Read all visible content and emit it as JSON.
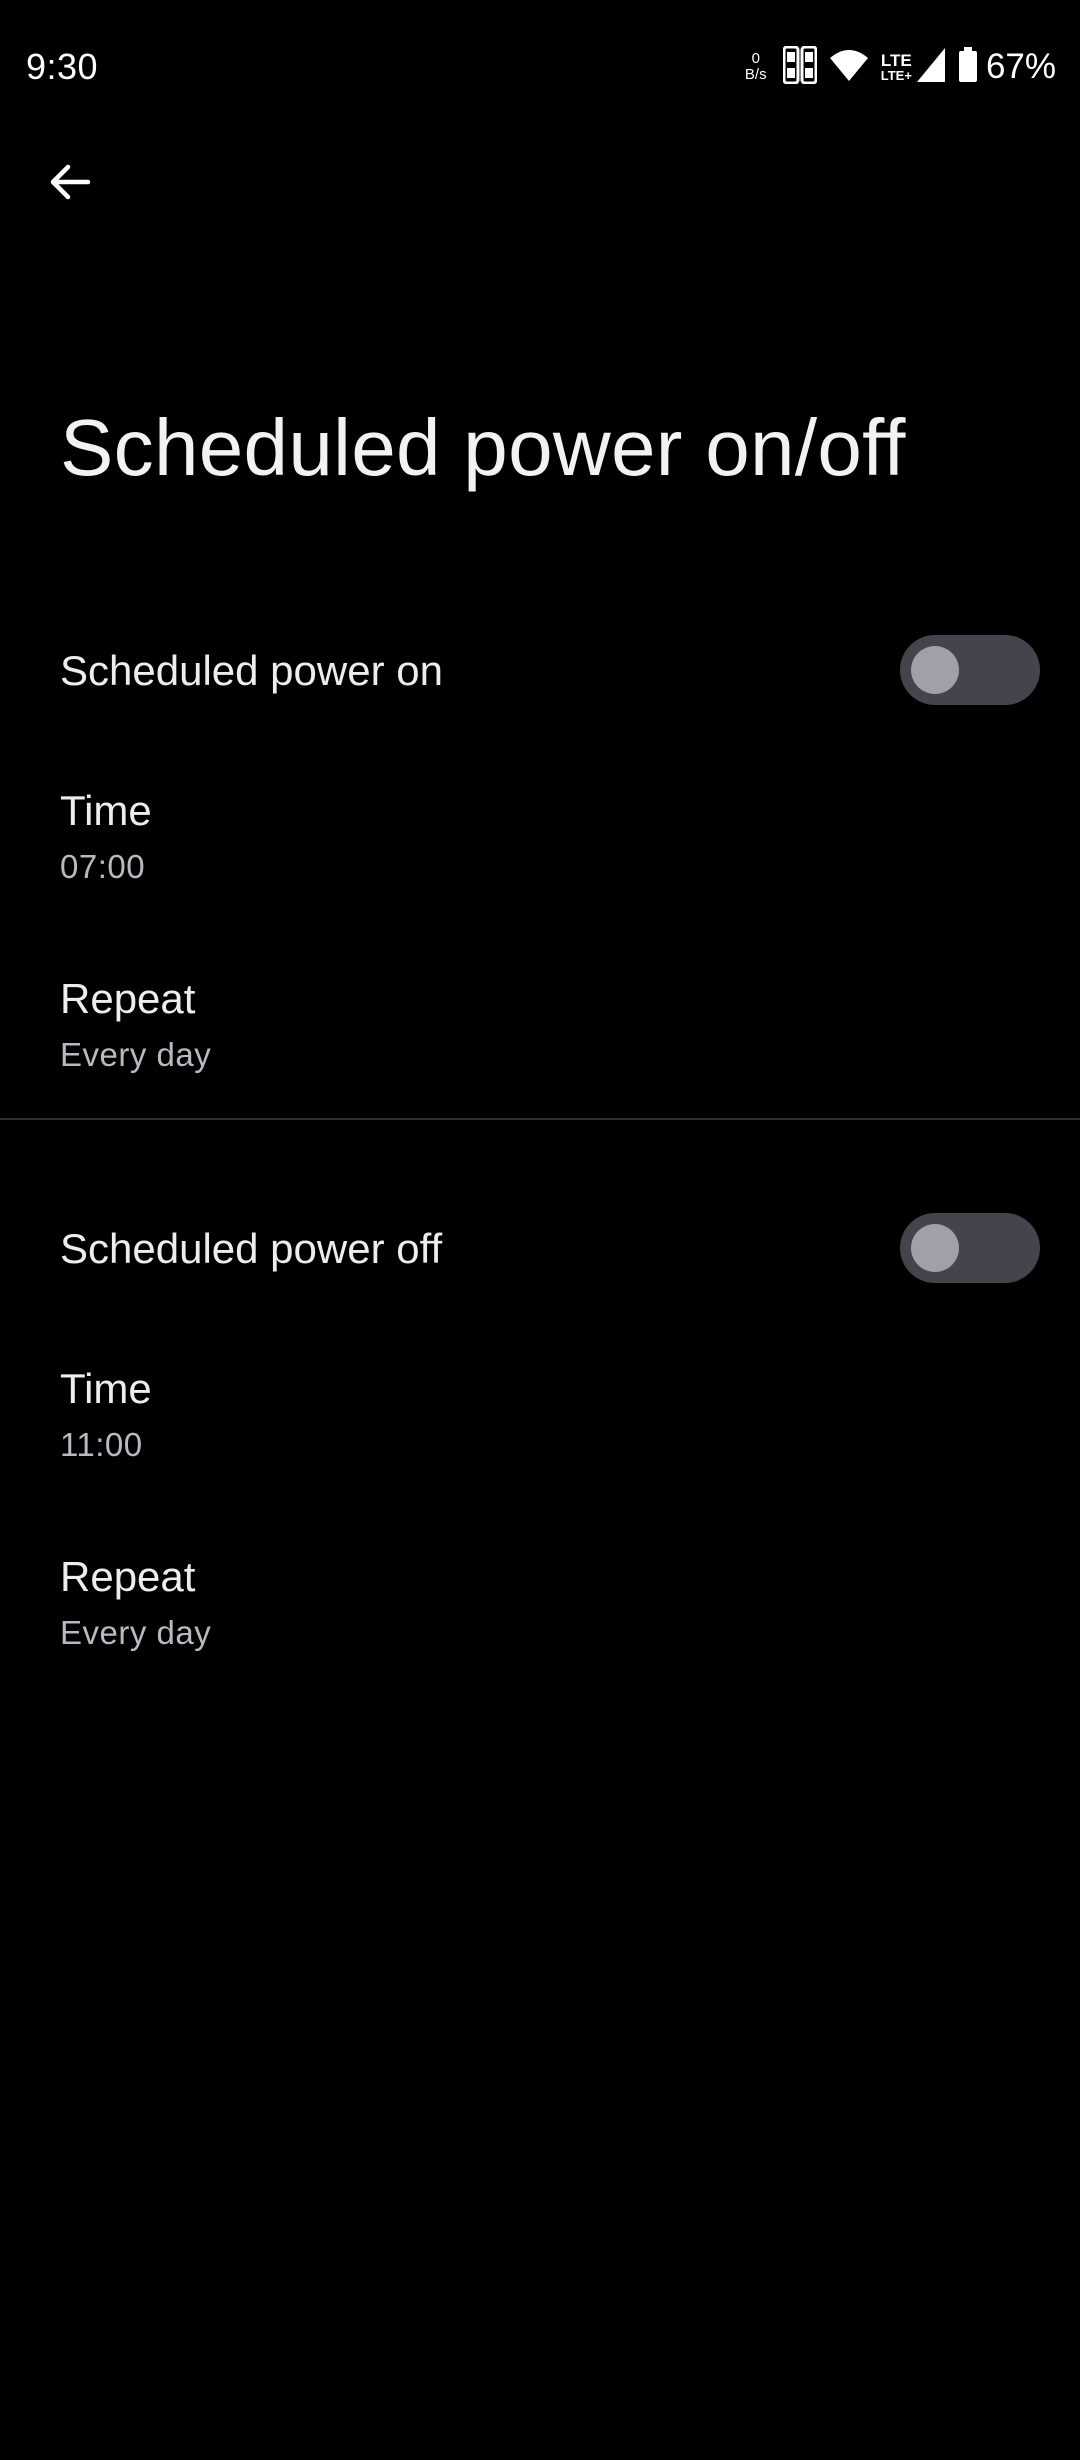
{
  "status_bar": {
    "time": "9:30",
    "net_speed_value": "0",
    "net_speed_unit": "B/s",
    "network_type_top": "LTE",
    "network_type_bottom": "LTE+",
    "battery_percent": "67%",
    "icons": [
      "sim-icon",
      "wifi-icon",
      "signal-icon",
      "battery-icon"
    ]
  },
  "header": {
    "back_icon": "arrow-back-icon",
    "title": "Scheduled power on/off"
  },
  "power_on": {
    "toggle_label": "Scheduled power on",
    "toggle_on": false,
    "time_title": "Time",
    "time_value": "07:00",
    "repeat_title": "Repeat",
    "repeat_value": "Every day"
  },
  "power_off": {
    "toggle_label": "Scheduled power off",
    "toggle_on": false,
    "time_title": "Time",
    "time_value": "11:00",
    "repeat_title": "Repeat",
    "repeat_value": "Every day"
  },
  "colors": {
    "background": "#000000",
    "text_primary": "#EDEDF0",
    "text_secondary": "#B9B9C2",
    "toggle_track_off": "#45434B",
    "toggle_knob_off": "#A19FA8"
  }
}
